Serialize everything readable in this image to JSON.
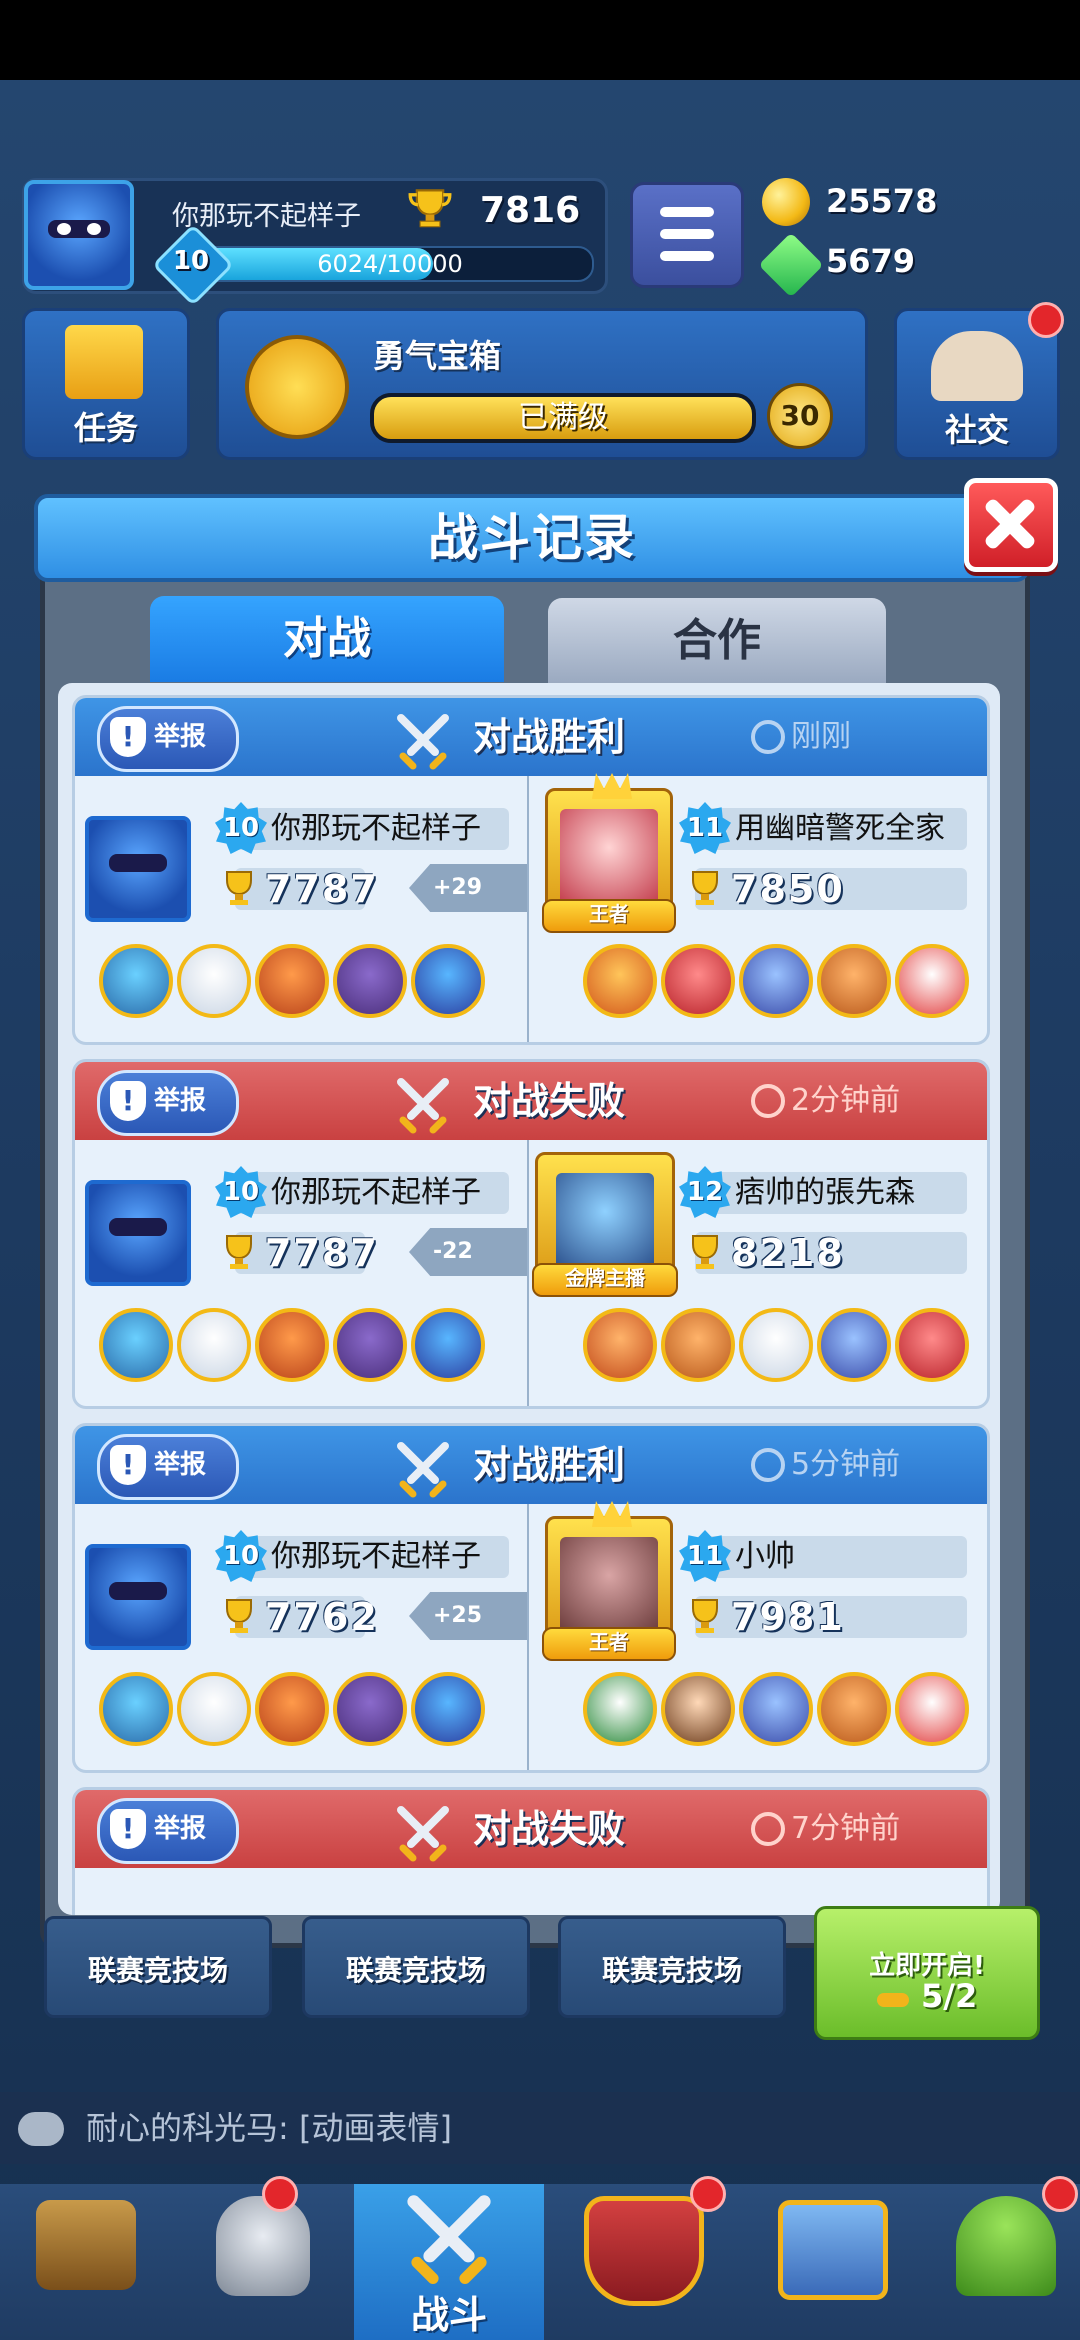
{
  "profile": {
    "name": "你那玩不起样子",
    "trophies": "7816",
    "level": "10",
    "xp": "6024/10000",
    "xp_fraction": 0.6024
  },
  "currency": {
    "coins": "25578",
    "gems": "5679"
  },
  "tiles": {
    "tasks": "任务",
    "social": "社交"
  },
  "chest": {
    "title": "勇气宝箱",
    "status": "已满级",
    "count": "30",
    "fill_fraction": 1.0
  },
  "modal": {
    "title": "战斗记录",
    "tabs": [
      "对战",
      "合作"
    ]
  },
  "records": [
    {
      "result": "对战胜利",
      "outcome": "win",
      "time": "刚刚",
      "report": "举报",
      "left": {
        "level": "10",
        "name": "你那玩不起样子",
        "trophies": "7787",
        "delta": "+29"
      },
      "right": {
        "level": "11",
        "name": "用幽暗警死全家",
        "trophies": "7850",
        "frame_tag": "王者"
      }
    },
    {
      "result": "对战失败",
      "outcome": "lose",
      "time": "2分钟前",
      "report": "举报",
      "left": {
        "level": "10",
        "name": "你那玩不起样子",
        "trophies": "7787",
        "delta": "-22"
      },
      "right": {
        "level": "12",
        "name": "痞帅的張先森",
        "trophies": "8218",
        "frame_tag": "金牌主播"
      }
    },
    {
      "result": "对战胜利",
      "outcome": "win",
      "time": "5分钟前",
      "report": "举报",
      "left": {
        "level": "10",
        "name": "你那玩不起样子",
        "trophies": "7762",
        "delta": "+25"
      },
      "right": {
        "level": "11",
        "name": "小帅",
        "trophies": "7981",
        "frame_tag": "王者"
      }
    },
    {
      "result": "对战失败",
      "outcome": "lose",
      "time": "7分钟前",
      "report": "举报"
    }
  ],
  "arenas": [
    "联赛竞技场",
    "联赛竞技场",
    "联赛竞技场"
  ],
  "open_now": {
    "label": "立即开启!",
    "keys": "5/2"
  },
  "chat": {
    "message": "耐心的科光马: [动画表情]"
  },
  "nav": {
    "active_label": "战斗"
  },
  "colors": {
    "win": "#2b74cc",
    "lose": "#c94141",
    "accent": "#1a7ce4"
  },
  "icons": [
    "trophy-icon",
    "coin-icon",
    "gem-icon",
    "menu-icon",
    "close-icon",
    "shield-icon",
    "crossed-swords-icon",
    "clock-icon",
    "chest-icon",
    "helmet-icon",
    "crown-shield-icon",
    "friends-icon",
    "sprout-icon",
    "chat-icon"
  ]
}
